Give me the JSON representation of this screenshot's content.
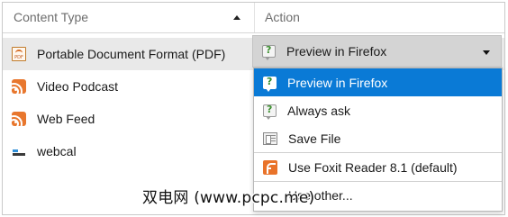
{
  "header": {
    "content_type_label": "Content Type",
    "action_label": "Action"
  },
  "rows": [
    {
      "content_type": "Portable Document Format (PDF)",
      "icon": "pdf-icon"
    },
    {
      "content_type": "Video Podcast",
      "icon": "rss-feed-icon"
    },
    {
      "content_type": "Web Feed",
      "icon": "rss-feed-icon"
    },
    {
      "content_type": "webcal",
      "icon": "webcal-icon"
    }
  ],
  "action_select": {
    "selected_value": "Preview in Firefox",
    "icon": "preview-icon"
  },
  "dropdown_menu": {
    "items": [
      {
        "label": "Preview in Firefox",
        "icon": "preview-icon",
        "selected": true
      },
      {
        "label": "Always ask",
        "icon": "ask-icon",
        "selected": false
      },
      {
        "label": "Save File",
        "icon": "save-file-icon",
        "selected": false
      },
      {
        "label": "Use Foxit Reader 8.1 (default)",
        "icon": "foxit-reader-icon",
        "selected": false
      },
      {
        "label": "Use other...",
        "icon": "",
        "selected": false
      }
    ]
  },
  "watermark": "双电网 (www.pcpc.me)",
  "colors": {
    "selection_blue": "#0a7ad6",
    "selected_row_gray": "#e9e9e9",
    "select_gray": "#d4d4d4",
    "rss_orange": "#e8772e",
    "foxit_orange": "#e9732a"
  }
}
